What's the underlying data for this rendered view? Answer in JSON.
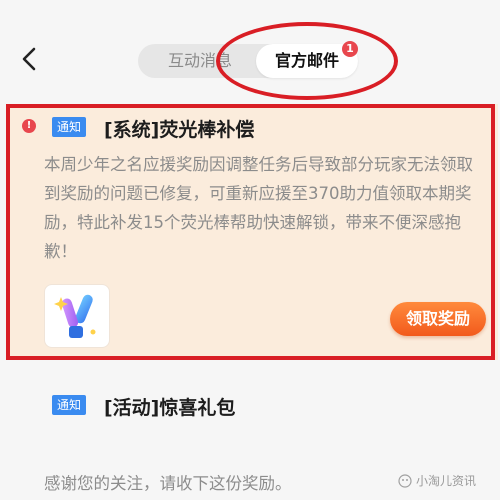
{
  "header": {
    "tabs": [
      {
        "label": "互动消息",
        "active": false
      },
      {
        "label": "官方邮件",
        "active": true
      }
    ],
    "official_badge": "1"
  },
  "mails": [
    {
      "tag": "通知",
      "title": "[系统]荧光棒补偿",
      "unread": true,
      "body": "本周少年之名应援奖励因调整任务后导致部分玩家无法领取到奖励的问题已修复，可重新应援至370助力值领取本期奖励，特此补发15个荧光棒帮助快速解锁，带来不便深感抱歉！",
      "reward_icon": "glow-stick-icon",
      "claim_label": "领取奖励"
    },
    {
      "tag": "通知",
      "title": "[活动]惊喜礼包",
      "unread": false,
      "body": "感谢您的关注，请收下这份奖励。"
    }
  ],
  "watermark": "小淘儿资讯",
  "colors": {
    "annotation_red": "#d91e25",
    "tag_blue": "#3a8bf0",
    "claim_orange": "#f25a1c",
    "card_highlight": "#fbecdc"
  }
}
